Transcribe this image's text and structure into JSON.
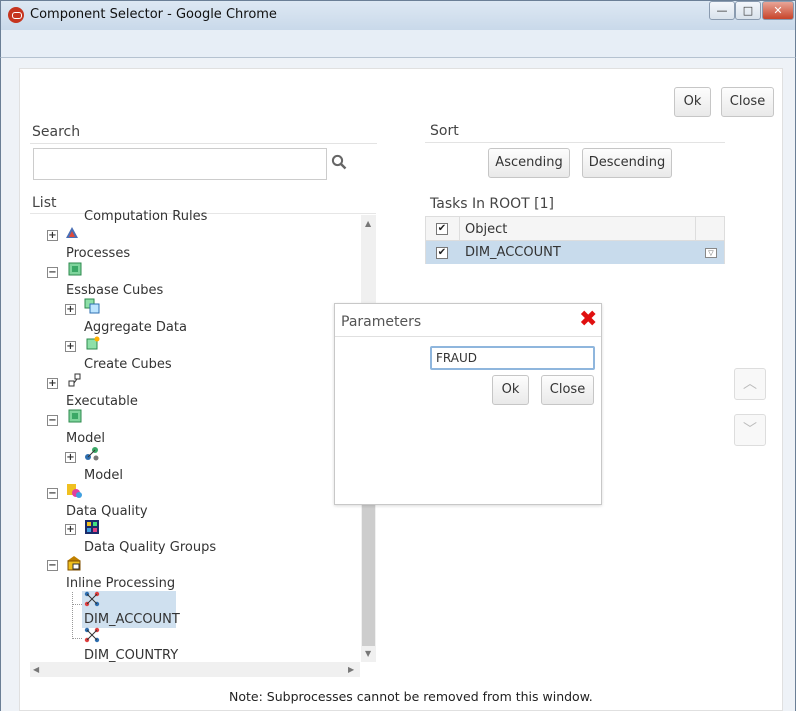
{
  "window": {
    "title": "Component Selector - Google Chrome",
    "minimize_glyph": "—",
    "maximize_glyph": "□",
    "close_glyph": "✕"
  },
  "toolbar": {
    "ok_label": "Ok",
    "close_label": "Close"
  },
  "search": {
    "heading": "Search",
    "value": "",
    "icon": "search-icon"
  },
  "sort": {
    "heading": "Sort",
    "ascending_label": "Ascending",
    "descending_label": "Descending"
  },
  "list": {
    "heading": "List",
    "items": [
      {
        "label": "Computation Rules"
      },
      {
        "label": "Processes"
      },
      {
        "label": "Essbase Cubes"
      },
      {
        "label": "Aggregate Data"
      },
      {
        "label": "Create Cubes"
      },
      {
        "label": "Executable"
      },
      {
        "label": "Model"
      },
      {
        "label": "Model"
      },
      {
        "label": "Data Quality"
      },
      {
        "label": "Data Quality Groups"
      },
      {
        "label": "Inline Processing"
      },
      {
        "label": "DIM_ACCOUNT"
      },
      {
        "label": "DIM_COUNTRY"
      }
    ]
  },
  "tasks": {
    "heading": "Tasks In ROOT [1]",
    "column_object": "Object",
    "rows": [
      {
        "object": "DIM_ACCOUNT",
        "checked": true
      }
    ]
  },
  "dialog": {
    "title": "Parameters",
    "input_value": "FRAUD",
    "ok_label": "Ok",
    "close_label": "Close"
  },
  "note": "Note: Subprocesses cannot be removed from this window.",
  "colors": {
    "selected_row": "#c8dbec",
    "dialog_close": "#e01010"
  }
}
